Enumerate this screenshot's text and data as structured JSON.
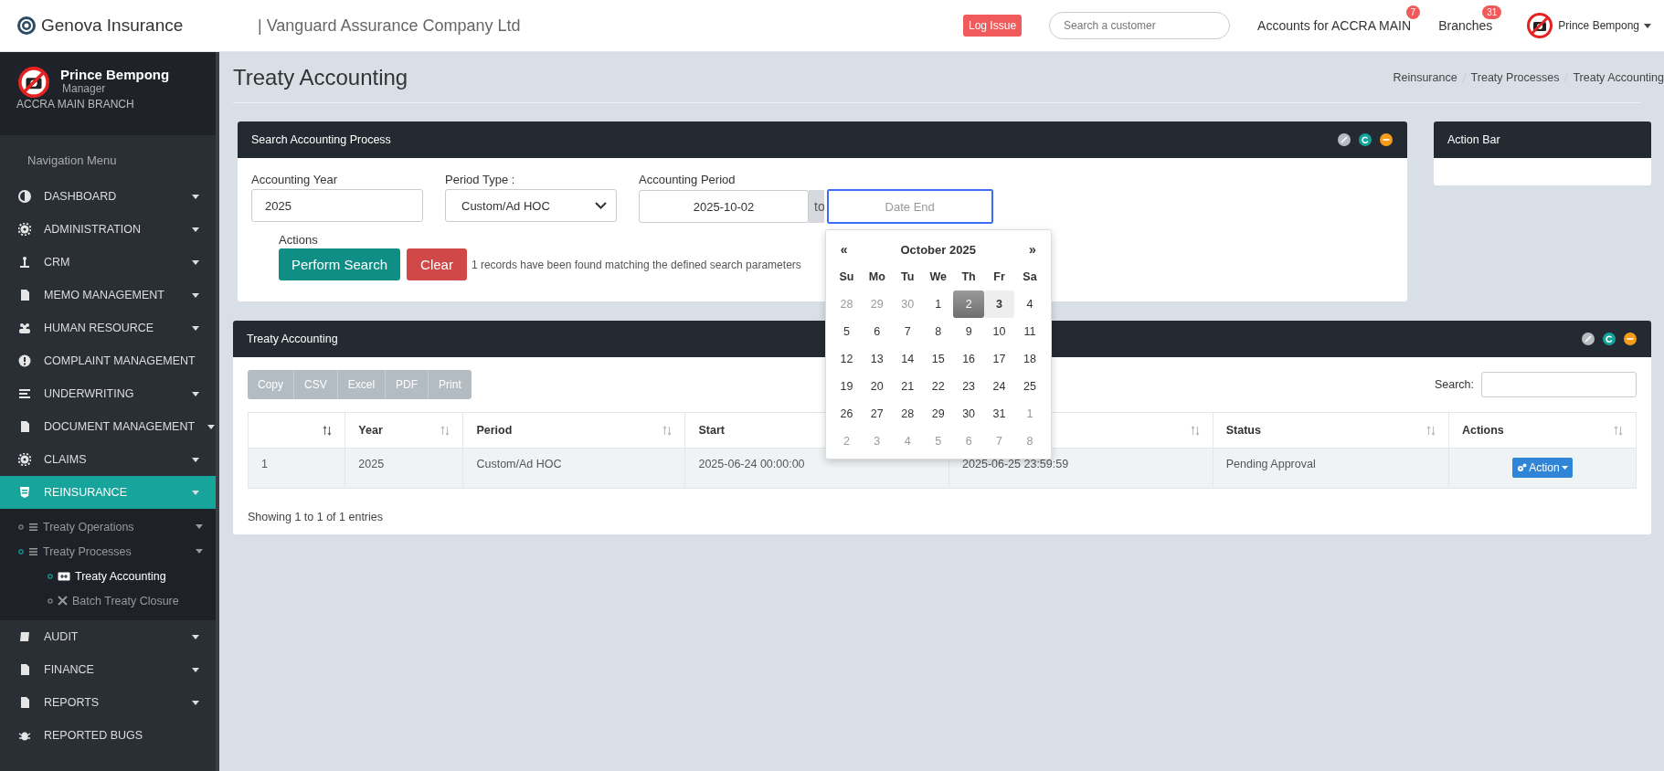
{
  "header": {
    "brand": "Genova Insurance",
    "company": "| Vanguard Assurance Company Ltd",
    "log_issue": "Log Issue",
    "search_placeholder": "Search a customer",
    "accounts": {
      "label": "Accounts for ACCRA MAIN",
      "badge": "7"
    },
    "branches": {
      "label": "Branches",
      "badge": "31"
    },
    "user": "Prince Bempong"
  },
  "sidebar": {
    "user_name": "Prince Bempong",
    "role": "Manager",
    "branch": "ACCRA MAIN BRANCH",
    "menu_title": "Navigation Menu",
    "items": [
      {
        "label": "DASHBOARD",
        "selected": false,
        "has_submenu": true
      },
      {
        "label": "ADMINISTRATION",
        "selected": false,
        "has_submenu": true
      },
      {
        "label": "CRM",
        "selected": false,
        "has_submenu": true
      },
      {
        "label": "MEMO MANAGEMENT",
        "selected": false,
        "has_submenu": true
      },
      {
        "label": "HUMAN RESOURCE",
        "selected": false,
        "has_submenu": true
      },
      {
        "label": "COMPLAINT MANAGEMENT",
        "selected": false,
        "has_submenu": false
      },
      {
        "label": "UNDERWRITING",
        "selected": false,
        "has_submenu": true
      },
      {
        "label": "DOCUMENT MANAGEMENT",
        "selected": false,
        "has_submenu": true
      },
      {
        "label": "CLAIMS",
        "selected": false,
        "has_submenu": true
      },
      {
        "label": "REINSURANCE",
        "selected": true,
        "has_submenu": true,
        "children": [
          {
            "label": "Treaty Operations",
            "selected": false,
            "has_submenu": true
          },
          {
            "label": "Treaty Processes",
            "selected": false,
            "has_submenu": true,
            "children": [
              {
                "label": "Treaty Accounting",
                "selected": true
              },
              {
                "label": "Batch Treaty Closure",
                "selected": false
              }
            ]
          }
        ]
      },
      {
        "label": "AUDIT",
        "selected": false,
        "has_submenu": true
      },
      {
        "label": "FINANCE",
        "selected": false,
        "has_submenu": true
      },
      {
        "label": "REPORTS",
        "selected": false,
        "has_submenu": true
      },
      {
        "label": "REPORTED BUGS",
        "selected": false,
        "has_submenu": false
      }
    ]
  },
  "page_title": "Treaty Accounting",
  "breadcrumb": [
    "Reinsurance",
    "Treaty Processes",
    "Treaty Accounting"
  ],
  "search_panel": {
    "title": "Search Accounting Process",
    "year": {
      "label": "Accounting Year",
      "value": "2025"
    },
    "period_type": {
      "label": "Period Type :",
      "value": "Custom/Ad HOC"
    },
    "period": {
      "label": "Accounting Period",
      "start": "2025-10-02",
      "separator": "to",
      "end_placeholder": "Date End"
    },
    "actions_label": "Actions",
    "search_button": "Perform Search",
    "clear_button": "Clear",
    "message": "1 records have been found matching the defined search parameters"
  },
  "calendar": {
    "prev": "«",
    "title": "October 2025",
    "next": "»",
    "weekdays": [
      "Su",
      "Mo",
      "Tu",
      "We",
      "Th",
      "Fr",
      "Sa"
    ],
    "weeks": [
      [
        {
          "day": "28",
          "muted": true,
          "selected": false,
          "highlighted": false
        },
        {
          "day": "29",
          "muted": true,
          "selected": false,
          "highlighted": false
        },
        {
          "day": "30",
          "muted": true,
          "selected": false,
          "highlighted": false
        },
        {
          "day": "1",
          "muted": false,
          "selected": false,
          "highlighted": false
        },
        {
          "day": "2",
          "muted": false,
          "selected": true,
          "highlighted": false
        },
        {
          "day": "3",
          "muted": false,
          "selected": false,
          "highlighted": true
        },
        {
          "day": "4",
          "muted": false,
          "selected": false,
          "highlighted": false
        }
      ],
      [
        {
          "day": "5",
          "muted": false,
          "selected": false,
          "highlighted": false
        },
        {
          "day": "6",
          "muted": false,
          "selected": false,
          "highlighted": false
        },
        {
          "day": "7",
          "muted": false,
          "selected": false,
          "highlighted": false
        },
        {
          "day": "8",
          "muted": false,
          "selected": false,
          "highlighted": false
        },
        {
          "day": "9",
          "muted": false,
          "selected": false,
          "highlighted": false
        },
        {
          "day": "10",
          "muted": false,
          "selected": false,
          "highlighted": false
        },
        {
          "day": "11",
          "muted": false,
          "selected": false,
          "highlighted": false
        }
      ],
      [
        {
          "day": "12",
          "muted": false,
          "selected": false,
          "highlighted": false
        },
        {
          "day": "13",
          "muted": false,
          "selected": false,
          "highlighted": false
        },
        {
          "day": "14",
          "muted": false,
          "selected": false,
          "highlighted": false
        },
        {
          "day": "15",
          "muted": false,
          "selected": false,
          "highlighted": false
        },
        {
          "day": "16",
          "muted": false,
          "selected": false,
          "highlighted": false
        },
        {
          "day": "17",
          "muted": false,
          "selected": false,
          "highlighted": false
        },
        {
          "day": "18",
          "muted": false,
          "selected": false,
          "highlighted": false
        }
      ],
      [
        {
          "day": "19",
          "muted": false,
          "selected": false,
          "highlighted": false
        },
        {
          "day": "20",
          "muted": false,
          "selected": false,
          "highlighted": false
        },
        {
          "day": "21",
          "muted": false,
          "selected": false,
          "highlighted": false
        },
        {
          "day": "22",
          "muted": false,
          "selected": false,
          "highlighted": false
        },
        {
          "day": "23",
          "muted": false,
          "selected": false,
          "highlighted": false
        },
        {
          "day": "24",
          "muted": false,
          "selected": false,
          "highlighted": false
        },
        {
          "day": "25",
          "muted": false,
          "selected": false,
          "highlighted": false
        }
      ],
      [
        {
          "day": "26",
          "muted": false,
          "selected": false,
          "highlighted": false
        },
        {
          "day": "27",
          "muted": false,
          "selected": false,
          "highlighted": false
        },
        {
          "day": "28",
          "muted": false,
          "selected": false,
          "highlighted": false
        },
        {
          "day": "29",
          "muted": false,
          "selected": false,
          "highlighted": false
        },
        {
          "day": "30",
          "muted": false,
          "selected": false,
          "highlighted": false
        },
        {
          "day": "31",
          "muted": false,
          "selected": false,
          "highlighted": false
        },
        {
          "day": "1",
          "muted": true,
          "selected": false,
          "highlighted": false
        }
      ],
      [
        {
          "day": "2",
          "muted": true,
          "selected": false,
          "highlighted": false
        },
        {
          "day": "3",
          "muted": true,
          "selected": false,
          "highlighted": false
        },
        {
          "day": "4",
          "muted": true,
          "selected": false,
          "highlighted": false
        },
        {
          "day": "5",
          "muted": true,
          "selected": false,
          "highlighted": false
        },
        {
          "day": "6",
          "muted": true,
          "selected": false,
          "highlighted": false
        },
        {
          "day": "7",
          "muted": true,
          "selected": false,
          "highlighted": false
        },
        {
          "day": "8",
          "muted": true,
          "selected": false,
          "highlighted": false
        }
      ]
    ]
  },
  "action_bar": {
    "title": "Action Bar"
  },
  "table_panel": {
    "title": "Treaty Accounting",
    "export_buttons": [
      "Copy",
      "CSV",
      "Excel",
      "PDF",
      "Print"
    ],
    "search_label": "Search:",
    "columns": [
      {},
      {
        "label": "Year"
      },
      {
        "label": "Period"
      },
      {
        "label": "Start"
      },
      {},
      {
        "label": "Status"
      },
      {
        "label": "Actions"
      }
    ],
    "rows": [
      {
        "cells": [
          "1",
          "2025",
          "Custom/Ad HOC",
          "2025-06-24 00:00:00",
          "2025-06-25 23:59:59",
          "Pending Approval"
        ],
        "action": "Action"
      }
    ],
    "footer": "Showing 1 to 1 of 1 entries"
  }
}
